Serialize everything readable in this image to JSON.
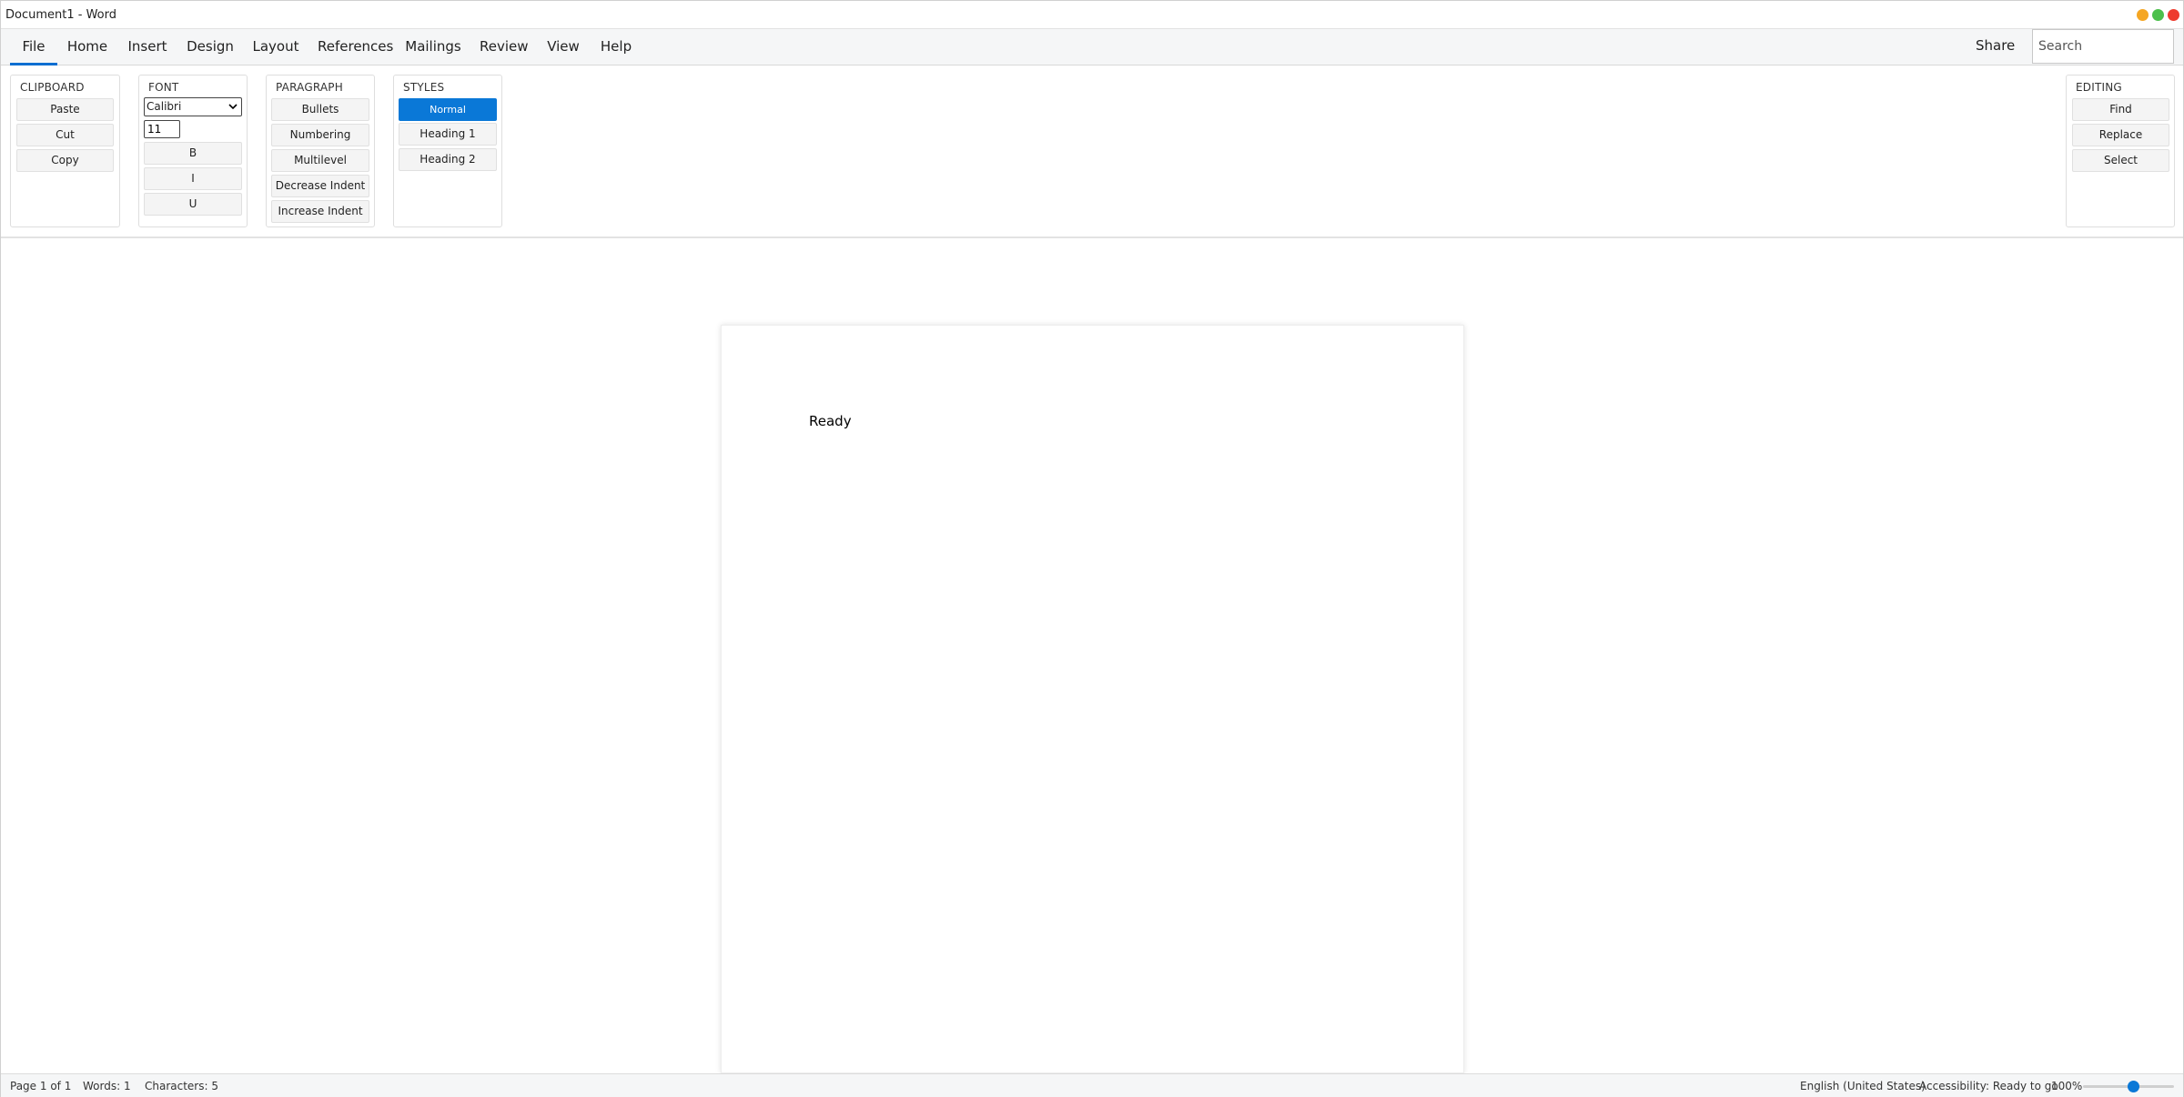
{
  "window": {
    "title": "Document1 - Word",
    "controls": {
      "minimize_color": "#f5a623",
      "maximize_color": "#4cc04c",
      "close_color": "#ee3b2e"
    }
  },
  "tabs": [
    {
      "label": "File",
      "active": true
    },
    {
      "label": "Home"
    },
    {
      "label": "Insert"
    },
    {
      "label": "Design"
    },
    {
      "label": "Layout"
    },
    {
      "label": "References"
    },
    {
      "label": "Mailings"
    },
    {
      "label": "Review"
    },
    {
      "label": "View"
    },
    {
      "label": "Help"
    }
  ],
  "header": {
    "share_label": "Share",
    "search_placeholder": "Search"
  },
  "ribbon": {
    "clipboard": {
      "label": "CLIPBOARD",
      "paste": "Paste",
      "cut": "Cut",
      "copy": "Copy"
    },
    "font": {
      "label": "FONT",
      "font_family": "Calibri",
      "font_size": "11",
      "bold": "B",
      "italic": "I",
      "underline": "U"
    },
    "paragraph": {
      "label": "PARAGRAPH",
      "bullets": "Bullets",
      "numbering": "Numbering",
      "multilevel": "Multilevel",
      "decrease_indent": "Decrease Indent",
      "increase_indent": "Increase Indent"
    },
    "styles": {
      "label": "STYLES",
      "normal": "Normal",
      "heading1": "Heading 1",
      "heading2": "Heading 2",
      "selected": "Normal"
    },
    "editing": {
      "label": "EDITING",
      "find": "Find",
      "replace": "Replace",
      "select": "Select"
    }
  },
  "document": {
    "text": "Ready"
  },
  "status": {
    "page": "Page 1 of 1",
    "words": "Words: 1",
    "characters": "Characters: 5",
    "language": "English (United States)",
    "accessibility": "Accessibility: Ready to go",
    "zoom": "100%",
    "zoom_fraction": 0.55
  },
  "colors": {
    "accent": "#0a78d7"
  }
}
